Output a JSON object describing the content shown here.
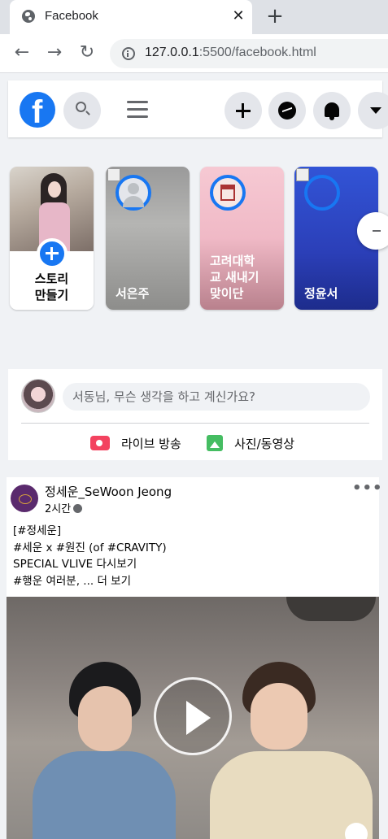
{
  "browser": {
    "tab_title": "Facebook",
    "close_glyph": "✕",
    "new_tab_glyph": "+",
    "back_glyph": "←",
    "forward_glyph": "→",
    "reload_glyph": "↻",
    "url_host": "127.0.0.1",
    "url_rest": ":5500/facebook.html"
  },
  "header": {
    "logo_letter": "f",
    "brand_color": "#1877f2",
    "icons": [
      "search-icon",
      "menu-icon",
      "plus-icon",
      "messenger-icon",
      "bell-icon",
      "caret-down-icon"
    ]
  },
  "stories": {
    "create_label_line1": "스토리",
    "create_label_line2": "만들기",
    "items": [
      {
        "name": "서은주"
      },
      {
        "name_line1": "고려대학",
        "name_line2": "교 새내기",
        "name_line3": "맞이단"
      },
      {
        "name": "정윤서"
      }
    ]
  },
  "composer": {
    "placeholder": "서동님, 무슨 생각을 하고 계신가요?",
    "live_label": "라이브 방송",
    "photo_label": "사진/동영상"
  },
  "post": {
    "author": "정세운_SeWoon Jeong",
    "time": "2시간",
    "more": "•••",
    "lines": [
      "[#정세운]",
      "#세운 x #원진 (of #CRAVITY)",
      "SPECIAL VLIVE 다시보기",
      "#행운 여러분, ... 더 보기"
    ]
  }
}
